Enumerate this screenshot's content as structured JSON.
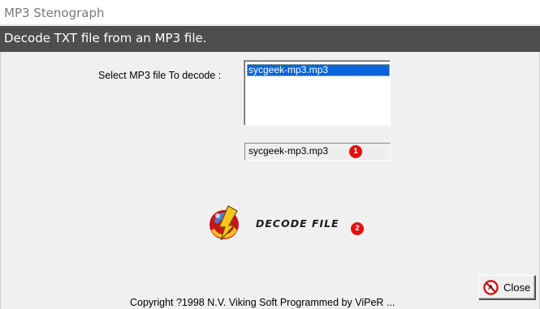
{
  "window": {
    "title": "MP3 Stenograph"
  },
  "header": {
    "text": "Decode TXT file from an MP3 file."
  },
  "select": {
    "label": "Select MP3 file To decode :",
    "items": [
      "sycgeek-mp3.mp3"
    ],
    "selected_index": 0
  },
  "filename_field": {
    "value": "sycgeek-mp3.mp3"
  },
  "badges": [
    "1",
    "2"
  ],
  "decode_button": {
    "label": "DECODE FILE",
    "icon": "decode-logo-icon"
  },
  "close_button": {
    "label": "Close",
    "icon": "no-entry-icon"
  },
  "footer": {
    "copyright": "Copyright ?1998 N.V. Viking Soft   Programmed by ViPeR ..."
  },
  "colors": {
    "header_band": "#4e4e4e",
    "selection": "#0a64d8",
    "badge": "#e01010"
  }
}
